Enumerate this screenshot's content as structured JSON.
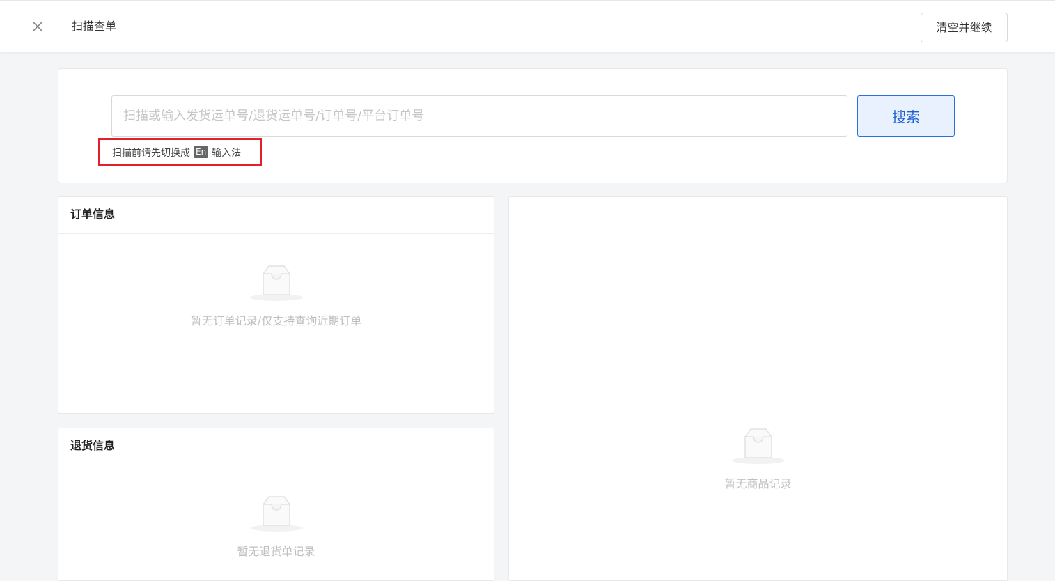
{
  "header": {
    "title": "扫描查单",
    "clear_button": "清空并继续"
  },
  "search": {
    "placeholder": "扫描或输入发货运单号/退货运单号/订单号/平台订单号",
    "button": "搜索",
    "tip_before": "扫描前请先切换成",
    "tip_badge": "En",
    "tip_after": "输入法"
  },
  "order_panel": {
    "title": "订单信息",
    "empty_text": "暂无订单记录/仅支持查询近期订单"
  },
  "return_panel": {
    "title": "退货信息",
    "empty_text": "暂无退货单记录"
  },
  "goods_panel": {
    "empty_text": "暂无商品记录"
  },
  "colors": {
    "accent": "#1d5fd0",
    "highlight": "#e0202a"
  },
  "icons": [
    "close-icon",
    "empty-inbox-icon"
  ]
}
